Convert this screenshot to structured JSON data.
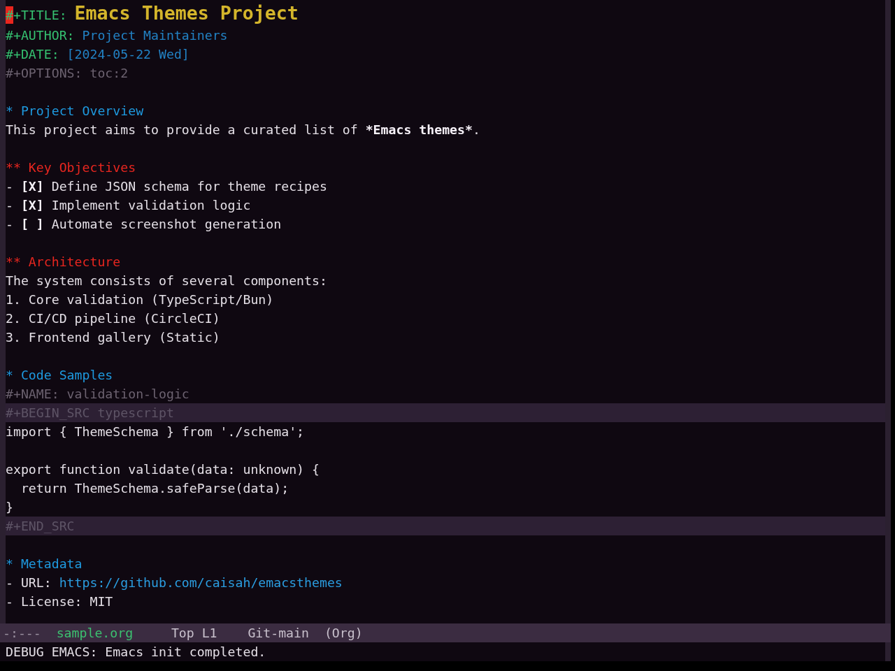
{
  "keywords": [
    {
      "kind": "title",
      "keyword": "#+TITLE:",
      "value": "Emacs Themes Project",
      "cursor": true
    },
    {
      "kind": "info",
      "keyword": "#+AUTHOR:",
      "value": "Project Maintainers",
      "cursor": false
    },
    {
      "kind": "info",
      "keyword": "#+DATE:",
      "value": "[2024-05-22 Wed]",
      "cursor": false
    },
    {
      "kind": "meta",
      "keyword": "#+OPTIONS:",
      "value": "toc:2",
      "cursor": false
    }
  ],
  "sections": [
    {
      "marker": "*",
      "title": "Project Overview",
      "body": [
        {
          "kind": "paragraph",
          "parts": [
            {
              "text": "This project aims to provide a curated list of ",
              "bold": false
            },
            {
              "text": "*Emacs themes*",
              "bold": true
            },
            {
              "text": ".",
              "bold": false
            }
          ]
        }
      ],
      "children": [
        {
          "marker": "**",
          "title": "Key Objectives",
          "body": [
            {
              "kind": "checkbox",
              "bullet": "-",
              "box": "[X]",
              "label": "Define JSON schema for theme recipes"
            },
            {
              "kind": "checkbox",
              "bullet": "-",
              "box": "[X]",
              "label": "Implement validation logic"
            },
            {
              "kind": "checkbox",
              "bullet": "-",
              "box": "[ ]",
              "label": "Automate screenshot generation"
            }
          ]
        },
        {
          "marker": "**",
          "title": "Architecture",
          "body": [
            {
              "kind": "paragraph",
              "parts": [
                {
                  "text": "The system consists of several components:",
                  "bold": false
                }
              ]
            },
            {
              "kind": "ordered",
              "number": "1.",
              "text": "Core validation (TypeScript/Bun)"
            },
            {
              "kind": "ordered",
              "number": "2.",
              "text": "CI/CD pipeline (CircleCI)"
            },
            {
              "kind": "ordered",
              "number": "3.",
              "text": "Frontend gallery (Static)"
            }
          ]
        }
      ]
    },
    {
      "marker": "*",
      "title": "Code Samples",
      "body": [
        {
          "kind": "src_block",
          "name_keyword": "#+NAME:",
          "name": "validation-logic",
          "begin": "#+BEGIN_SRC",
          "language": "typescript",
          "code": "import { ThemeSchema } from './schema';\n\nexport function validate(data: unknown) {\n  return ThemeSchema.safeParse(data);\n}",
          "end": "#+END_SRC"
        }
      ]
    },
    {
      "marker": "*",
      "title": "Metadata",
      "body": [
        {
          "kind": "field",
          "bullet": "-",
          "label": "URL:",
          "value": "https://github.com/caisah/emacsthemes",
          "link": true
        },
        {
          "kind": "field",
          "bullet": "-",
          "label": "License:",
          "value": "MIT",
          "link": false
        }
      ]
    }
  ],
  "mode_line": {
    "status": "-:---",
    "buffer": "sample.org",
    "position": "Top L1",
    "branch": "Git-main",
    "mode": "(Org)"
  },
  "echo_area": {
    "message": "DEBUG EMACS: Emacs init completed."
  }
}
